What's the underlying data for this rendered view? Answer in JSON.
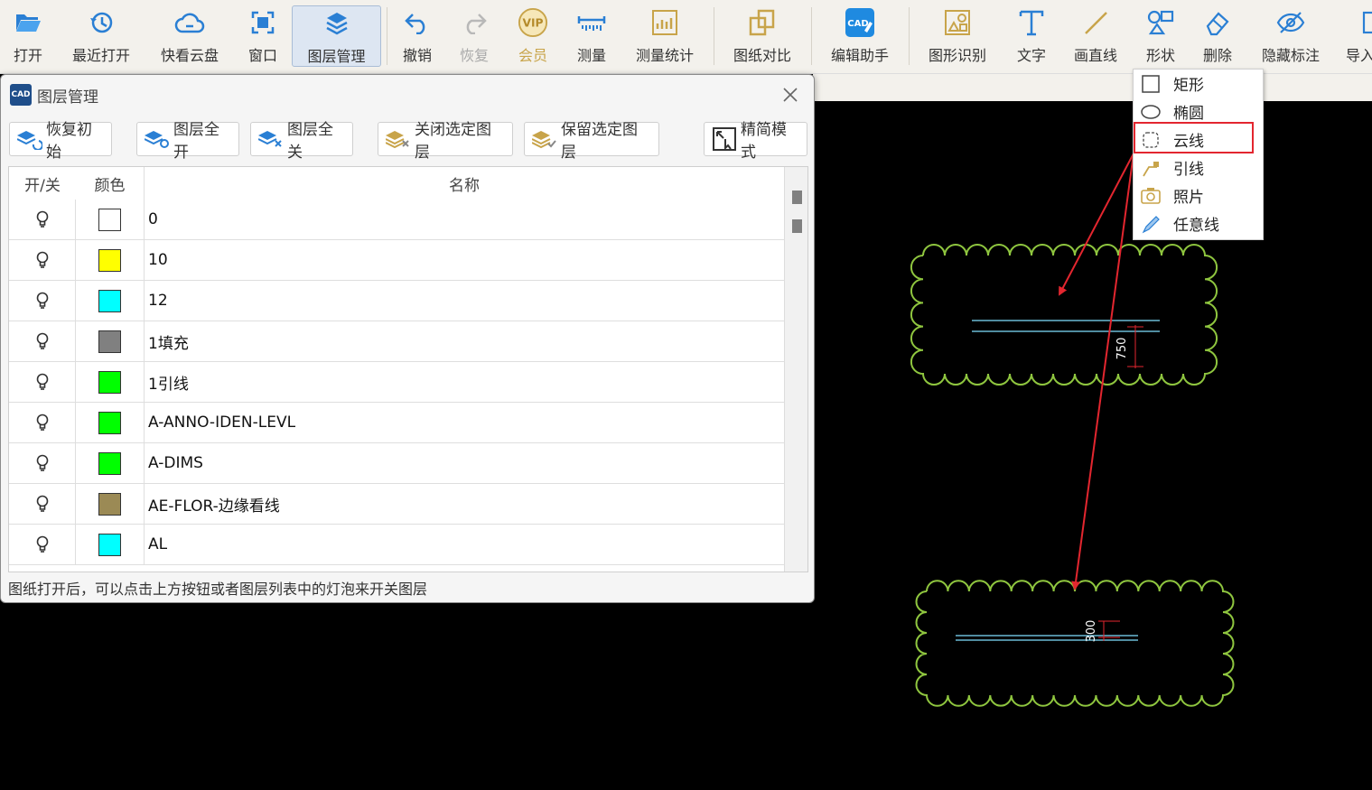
{
  "toolbar": {
    "open": "打开",
    "recent": "最近打开",
    "cloud": "快看云盘",
    "window": "窗口",
    "layer_mgmt": "图层管理",
    "undo": "撤销",
    "redo": "恢复",
    "vip": "会员",
    "vip_badge": "VIP",
    "measure": "测量",
    "measure_stats": "测量统计",
    "compare": "图纸对比",
    "edit_helper": "编辑助手",
    "edit_helper_badge": "CAD",
    "shape_recog": "图形识别",
    "text": "文字",
    "line": "画直线",
    "shape": "形状",
    "delete": "删除",
    "hide_mark": "隐藏标注",
    "import": "导入"
  },
  "dialog": {
    "logo": "CAD",
    "title": "图层管理",
    "buttons": {
      "restore": "恢复初始",
      "all_on": "图层全开",
      "all_off": "图层全关",
      "close_selected": "关闭选定图层",
      "keep_selected": "保留选定图层",
      "simple_mode": "精简模式"
    },
    "columns": {
      "toggle": "开/关",
      "color": "颜色",
      "name": "名称"
    },
    "rows": [
      {
        "name": "0",
        "color": "#ffffff"
      },
      {
        "name": "10",
        "color": "#ffff00"
      },
      {
        "name": "12",
        "color": "#00ffff"
      },
      {
        "name": "1填充",
        "color": "#808080"
      },
      {
        "name": "1引线",
        "color": "#00ff00"
      },
      {
        "name": "A-ANNO-IDEN-LEVL",
        "color": "#00ff00"
      },
      {
        "name": "A-DIMS",
        "color": "#00ff00"
      },
      {
        "name": "AE-FLOR-边缘看线",
        "color": "#9b8a55"
      },
      {
        "name": "AL",
        "color": "#00ffff"
      }
    ],
    "status": "图纸打开后，可以点击上方按钮或者图层列表中的灯泡来开关图层"
  },
  "shape_menu": {
    "items": [
      {
        "label": "矩形",
        "icon": "rectangle-icon"
      },
      {
        "label": "椭圆",
        "icon": "ellipse-icon"
      },
      {
        "label": "云线",
        "icon": "cloud-line-icon"
      },
      {
        "label": "引线",
        "icon": "leader-line-icon"
      },
      {
        "label": "照片",
        "icon": "camera-icon"
      },
      {
        "label": "任意线",
        "icon": "freehand-line-icon"
      }
    ],
    "selected": "云线"
  },
  "canvas": {
    "dim_upper": "750",
    "dim_lower": "300",
    "cloud_color": "#8fc63f",
    "line_color": "#7fe0ff",
    "dim_color": "#e3262f",
    "arrow_color": "#e3262f"
  }
}
